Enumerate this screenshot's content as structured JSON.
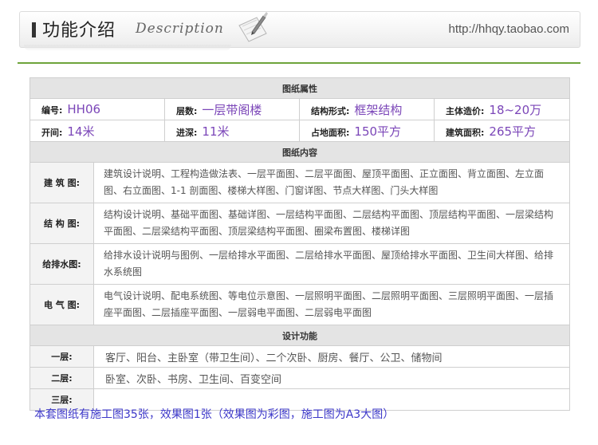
{
  "header": {
    "title": "功能介绍",
    "subtitle_en": "Description",
    "url": "http://hhqy.taobao.com"
  },
  "sections": {
    "attributes": "图纸属性",
    "contents": "图纸内容",
    "design": "设计功能"
  },
  "attributes": [
    [
      {
        "label": "编号:",
        "value": "HH06"
      },
      {
        "label": "层数:",
        "value": "一层带阁楼"
      },
      {
        "label": "结构形式:",
        "value": "框架结构"
      },
      {
        "label": "主体造价:",
        "value": "18~20万"
      }
    ],
    [
      {
        "label": "开间:",
        "value": "14米"
      },
      {
        "label": "进深:",
        "value": "11米"
      },
      {
        "label": "占地面积:",
        "value": "150平方"
      },
      {
        "label": "建筑面积:",
        "value": "265平方"
      }
    ]
  ],
  "drawings": [
    {
      "label": "建 筑 图:",
      "text": "建筑设计说明、工程构造做法表、一层平面图、二层平面图、屋顶平面图、正立面图、背立面图、左立面图、右立面图、1-1 剖面图、楼梯大样图、门窗详图、节点大样图、门头大样图"
    },
    {
      "label": "结 构 图:",
      "text": "结构设计说明、基础平面图、基础详图、一层结构平面图、二层结构平面图、顶层结构平面图、一层梁结构平面图、二层梁结构平面图、顶层梁结构平面图、圈梁布置图、楼梯详图"
    },
    {
      "label": "给排水图:",
      "text": "给排水设计说明与图例、一层给排水平面图、二层给排水平面图、屋顶给排水平面图、卫生间大样图、给排水系统图"
    },
    {
      "label": "电 气 图:",
      "text": "电气设计说明、配电系统图、等电位示意图、一层照明平面图、二层照明平面图、三层照明平面图、一层插座平面图、二层插座平面图、一层弱电平面图、二层弱电平面图"
    }
  ],
  "floors": [
    {
      "label": "一层:",
      "text": "客厅、阳台、主卧室（带卫生间）、二个次卧、厨房、餐厅、公卫、储物间"
    },
    {
      "label": "二层:",
      "text": "卧室、次卧、书房、卫生间、百变空间"
    },
    {
      "label": "三层:",
      "text": ""
    }
  ],
  "footer_note": "本套图纸有施工图35张，效果图1张（效果图为彩图，施工图为A3大图）"
}
